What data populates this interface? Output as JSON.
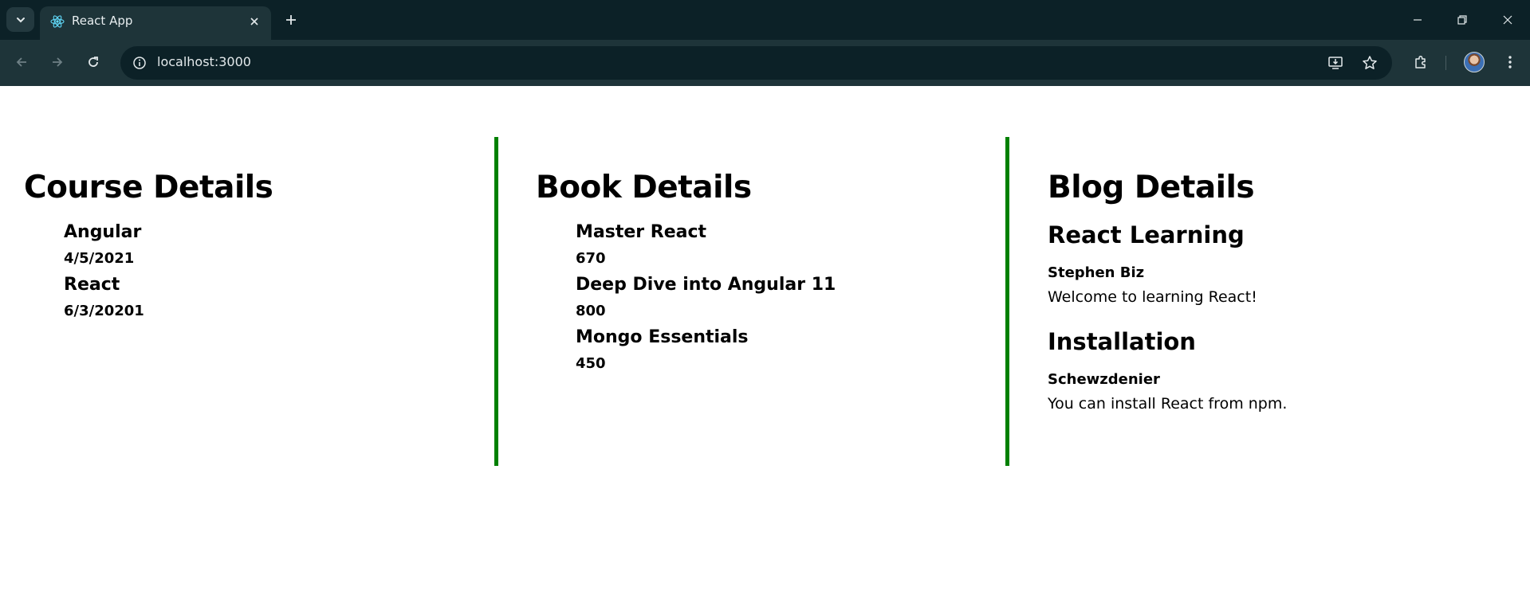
{
  "browser": {
    "tab_title": "React App",
    "url": "localhost:3000",
    "icons": {
      "tab_search": "chevron-down-icon",
      "favicon": "react-logo-icon",
      "tab_close": "close-icon",
      "new_tab": "plus-icon",
      "minimize": "minimize-icon",
      "restore": "restore-icon",
      "close_window": "close-icon",
      "back": "arrow-left-icon",
      "forward": "arrow-right-icon",
      "reload": "reload-icon",
      "site_info": "info-icon",
      "install": "install-app-icon",
      "bookmark": "star-icon",
      "extensions": "puzzle-icon",
      "menu": "kebab-menu-icon"
    }
  },
  "course": {
    "heading": "Course Details",
    "items": [
      {
        "name": "Angular",
        "date": "4/5/2021"
      },
      {
        "name": "React",
        "date": "6/3/20201"
      }
    ]
  },
  "book": {
    "heading": "Book Details",
    "items": [
      {
        "name": "Master React",
        "price": "670"
      },
      {
        "name": "Deep Dive into Angular 11",
        "price": "800"
      },
      {
        "name": "Mongo Essentials",
        "price": "450"
      }
    ]
  },
  "blog": {
    "heading": "Blog Details",
    "posts": [
      {
        "title": "React Learning",
        "author": "Stephen Biz",
        "text": "Welcome to learning React!"
      },
      {
        "title": "Installation",
        "author": "Schewzdenier",
        "text": "You can install React from npm."
      }
    ]
  },
  "colors": {
    "divider": "#008000",
    "chrome_dark": "#0c2127",
    "chrome_toolbar": "#1e3439"
  }
}
